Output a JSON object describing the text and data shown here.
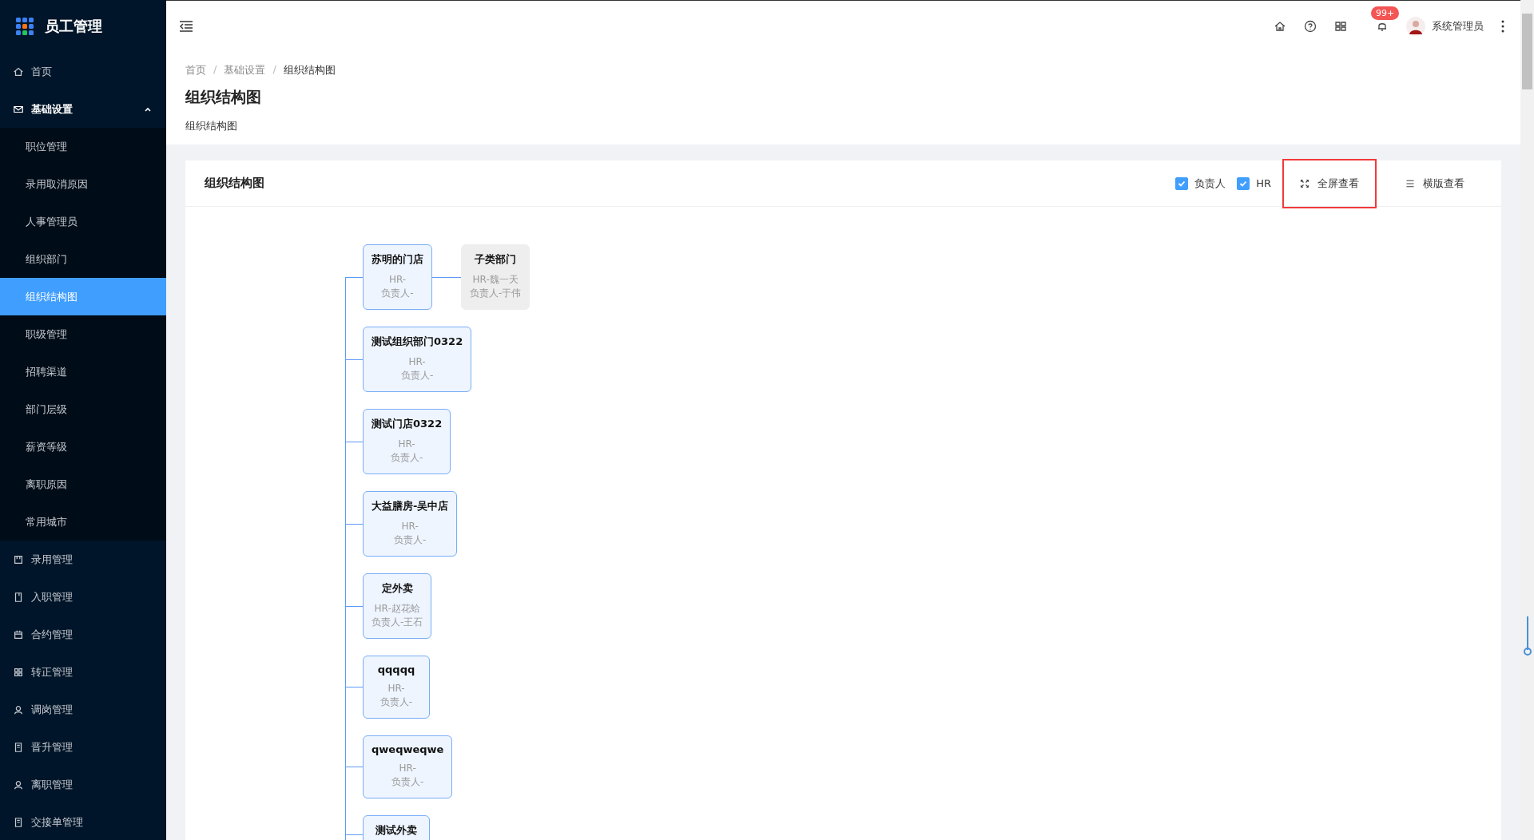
{
  "app": {
    "title": "员工管理"
  },
  "sidebar": {
    "items": [
      {
        "label": "首页"
      },
      {
        "label": "基础设置",
        "expanded": true,
        "children": [
          {
            "label": "职位管理",
            "selected": false
          },
          {
            "label": "录用取消原因",
            "selected": false
          },
          {
            "label": "人事管理员",
            "selected": false
          },
          {
            "label": "组织部门",
            "selected": false
          },
          {
            "label": "组织结构图",
            "selected": true
          },
          {
            "label": "职级管理",
            "selected": false
          },
          {
            "label": "招聘渠道",
            "selected": false
          },
          {
            "label": "部门层级",
            "selected": false
          },
          {
            "label": "薪资等级",
            "selected": false
          },
          {
            "label": "离职原因",
            "selected": false
          },
          {
            "label": "常用城市",
            "selected": false
          }
        ]
      },
      {
        "label": "录用管理"
      },
      {
        "label": "入职管理"
      },
      {
        "label": "合约管理"
      },
      {
        "label": "转正管理"
      },
      {
        "label": "调岗管理"
      },
      {
        "label": "晋升管理"
      },
      {
        "label": "离职管理"
      },
      {
        "label": "交接单管理"
      }
    ]
  },
  "header": {
    "notification_count": "99+",
    "user": "系统管理员"
  },
  "breadcrumb": {
    "items": [
      "首页",
      "基础设置",
      "组织结构图"
    ],
    "separators": [
      "/",
      "/"
    ]
  },
  "page": {
    "title": "组织结构图",
    "subtitle": "组织结构图"
  },
  "card": {
    "title": "组织结构图",
    "toggles": [
      {
        "label": "负责人",
        "checked": true
      },
      {
        "label": "HR",
        "checked": true
      }
    ],
    "actions": [
      {
        "label": "全屏查看",
        "highlighted": true
      },
      {
        "label": "横版查看",
        "highlighted": false
      }
    ],
    "tree": [
      {
        "name": "苏明的门店",
        "hr": "HR-",
        "leader": "负责人-",
        "disabled": false,
        "children": [
          {
            "name": "子类部门",
            "hr": "HR-魏一天",
            "leader": "负责人-于伟",
            "disabled": true
          }
        ]
      },
      {
        "name": "测试组织部门0322",
        "hr": "HR-",
        "leader": "负责人-",
        "disabled": false
      },
      {
        "name": "测试门店0322",
        "hr": "HR-",
        "leader": "负责人-",
        "disabled": false
      },
      {
        "name": "大益膳房-吴中店",
        "hr": "HR-",
        "leader": "负责人-",
        "disabled": false
      },
      {
        "name": "定外卖",
        "hr": "HR-赵花蛤",
        "leader": "负责人-王石",
        "disabled": false
      },
      {
        "name": "qqqqq",
        "hr": "HR-",
        "leader": "负责人-",
        "disabled": false
      },
      {
        "name": "qweqweqwe",
        "hr": "HR-",
        "leader": "负责人-",
        "disabled": false
      },
      {
        "name": "测试外卖",
        "disabled": false
      }
    ]
  }
}
